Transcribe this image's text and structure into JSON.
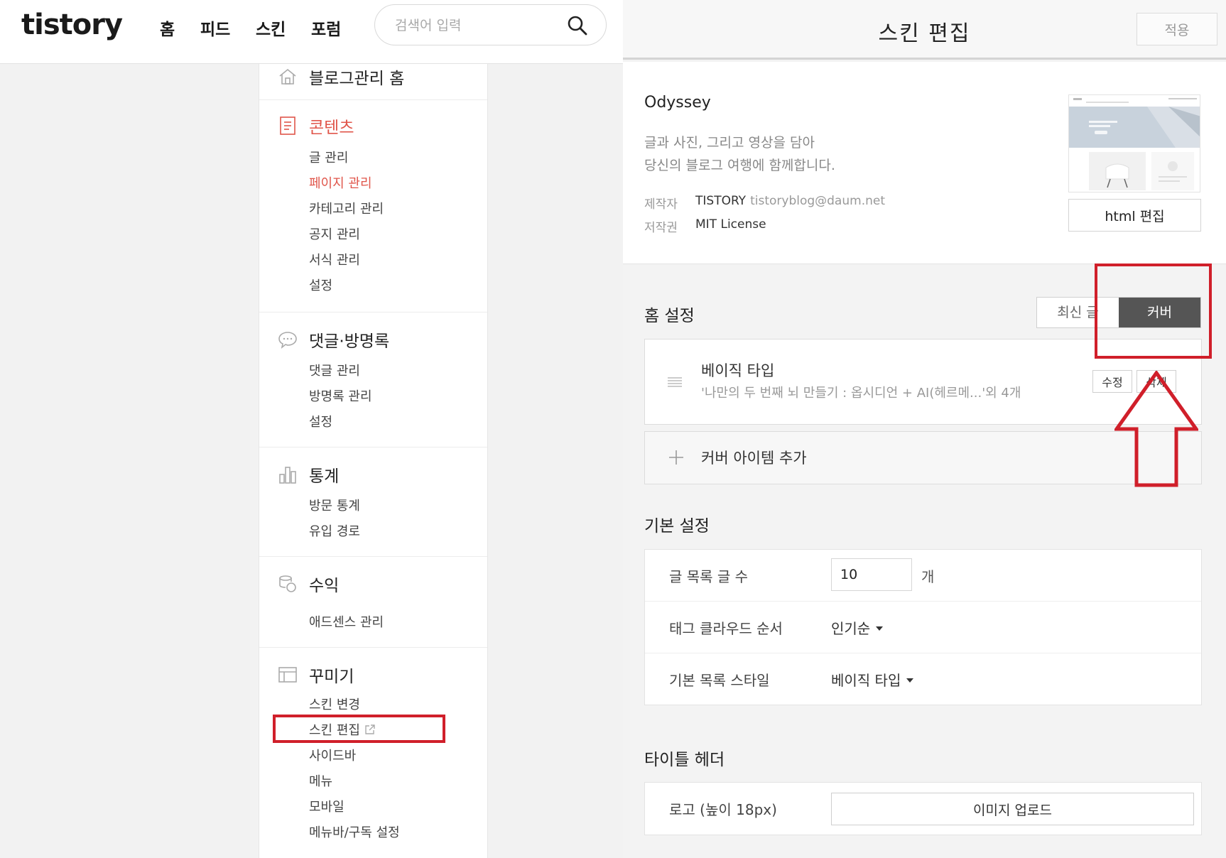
{
  "header": {
    "logo": "tistory",
    "nav": [
      "홈",
      "피드",
      "스킨",
      "포럼"
    ],
    "search_placeholder": "검색어 입력"
  },
  "sidebar": {
    "home": "블로그관리 홈",
    "sections": [
      {
        "title": "콘텐츠",
        "active": true,
        "items": [
          "글 관리",
          "페이지 관리",
          "카테고리 관리",
          "공지 관리",
          "서식 관리",
          "설정"
        ],
        "active_item": 1
      },
      {
        "title": "댓글·방명록",
        "items": [
          "댓글 관리",
          "방명록 관리",
          "설정"
        ]
      },
      {
        "title": "통계",
        "items": [
          "방문 통계",
          "유입 경로"
        ]
      },
      {
        "title": "수익",
        "items": [
          "애드센스 관리"
        ]
      },
      {
        "title": "꾸미기",
        "items": [
          "스킨 변경",
          "스킨 편집",
          "사이드바",
          "메뉴",
          "모바일",
          "메뉴바/구독 설정"
        ],
        "highlighted_item": 1
      }
    ]
  },
  "editor": {
    "title": "스킨 편집",
    "apply_label": "적용",
    "skin": {
      "name": "Odyssey",
      "desc_line1": "글과 사진, 그리고 영상을 담아",
      "desc_line2": "당신의 블로그 여행에 함께합니다.",
      "maker_label": "제작자",
      "maker_name": "TISTORY",
      "maker_email": "tistoryblog@daum.net",
      "license_label": "저작권",
      "license_value": "MIT License",
      "html_edit_label": "html 편집"
    },
    "home_settings": {
      "title": "홈 설정",
      "toggle_recent": "최신 글",
      "toggle_cover": "커버",
      "selected": "커버",
      "cover_item_title": "베이직 타입",
      "cover_item_sub": "'나만의 두 번째 뇌 만들기 : 옵시디언 + AI(헤르메...'외 4개",
      "edit_label": "수정",
      "delete_label": "삭제",
      "add_cover_label": "커버 아이템 추가"
    },
    "basic_settings": {
      "title": "기본 설정",
      "post_count_label": "글 목록 글 수",
      "post_count_value": "10",
      "post_count_unit": "개",
      "tag_order_label": "태그 클라우드 순서",
      "tag_order_value": "인기순",
      "list_style_label": "기본 목록 스타일",
      "list_style_value": "베이직 타입"
    },
    "title_header": {
      "title": "타이틀 헤더",
      "logo_label": "로고 (높이 18px)",
      "upload_label": "이미지 업로드"
    }
  },
  "colors": {
    "accent_red": "#e0554a",
    "annotation_red": "#d01f2a",
    "toggle_on": "#555555"
  }
}
